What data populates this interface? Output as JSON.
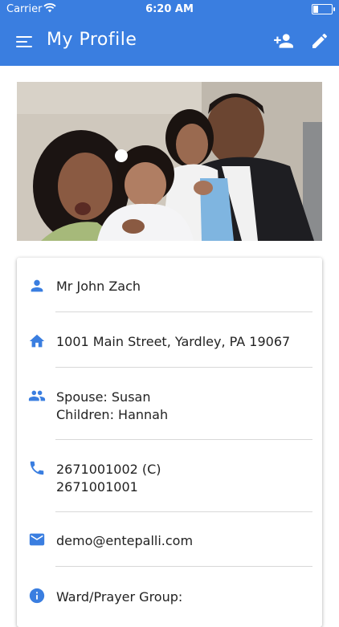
{
  "status_bar": {
    "carrier": "Carrier",
    "time": "6:20 AM"
  },
  "app_bar": {
    "title": "My Profile"
  },
  "profile": {
    "name": "Mr John Zach",
    "address": "1001 Main Street, Yardley, PA 19067",
    "family": {
      "spouse": "Spouse: Susan",
      "children": "Children: Hannah"
    },
    "phones": [
      "2671001002 (C)",
      "2671001001"
    ],
    "email": "demo@entepalli.com",
    "group": "Ward/Prayer Group:"
  },
  "icons": {
    "menu": "menu-icon",
    "add_user": "person-add-icon",
    "edit": "pencil-icon",
    "person": "person-icon",
    "home": "home-icon",
    "family": "people-icon",
    "phone": "phone-icon",
    "email": "email-icon",
    "info": "info-icon"
  },
  "colors": {
    "primary": "#3a7ee0",
    "icon": "#3a7ee0",
    "divider": "#d8d8d8"
  }
}
